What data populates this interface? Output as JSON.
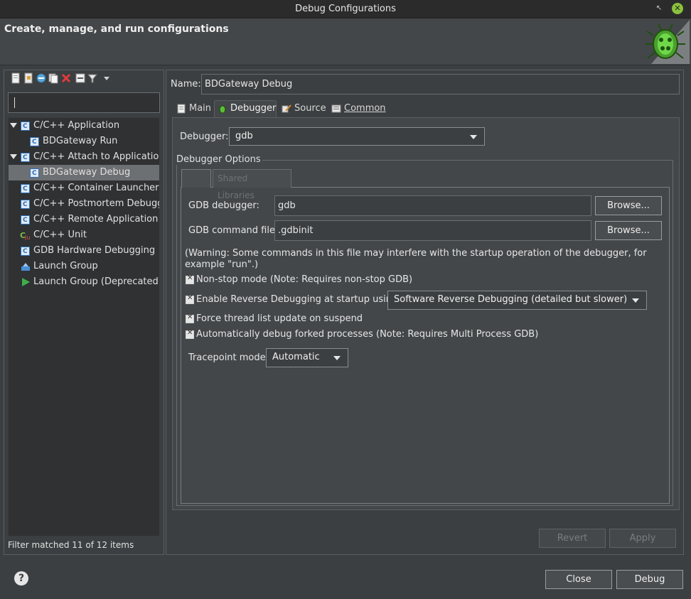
{
  "window": {
    "title": "Debug Configurations",
    "restore_glyph": "↖",
    "close_glyph": "✕"
  },
  "header": {
    "title": "Create, manage, and run configurations"
  },
  "left": {
    "filter_placeholder": "",
    "tree": [
      {
        "label": "C/C++ Application",
        "expanded": true,
        "level": 0
      },
      {
        "label": "BDGateway Run",
        "level": 1
      },
      {
        "label": "C/C++ Attach to Application",
        "expanded": true,
        "level": 0
      },
      {
        "label": "BDGateway Debug",
        "level": 1,
        "selected": true
      },
      {
        "label": "C/C++ Container Launcher",
        "level": 0
      },
      {
        "label": "C/C++ Postmortem Debugger",
        "level": 0
      },
      {
        "label": "C/C++ Remote Application",
        "level": 0
      },
      {
        "label": "C/C++ Unit",
        "level": 0
      },
      {
        "label": "GDB Hardware Debugging",
        "level": 0
      },
      {
        "label": "Launch Group",
        "level": 0
      },
      {
        "label": "Launch Group (Deprecated)",
        "level": 0
      }
    ],
    "status": "Filter matched 11 of 12 items"
  },
  "right": {
    "name_label": "Name:",
    "name_value": "BDGateway Debug",
    "tabs": [
      "Main",
      "Debugger",
      "Source",
      "Common"
    ],
    "active_tab": "Debugger",
    "debugger_label": "Debugger:",
    "debugger_value": "gdb",
    "options_label": "Debugger Options",
    "subtabs": [
      "",
      "Shared Libraries"
    ],
    "gdb_debugger_label": "GDB debugger:",
    "gdb_debugger_value": "gdb",
    "gdb_command_label": "GDB command file:",
    "gdb_command_value": ".gdbinit",
    "browse_label": "Browse...",
    "warning": "(Warning: Some commands in this file may interfere with the startup operation of the debugger, for example \"run\".)",
    "nonstop_label": "Non-stop mode (Note: Requires non-stop GDB)",
    "reverse_label": "Enable Reverse Debugging at startup using:",
    "reverse_value": "Software Reverse Debugging (detailed but slower)",
    "force_label": "Force thread list update on suspend",
    "forked_label": "Automatically debug forked processes (Note: Requires Multi Process GDB)",
    "tracepoint_label": "Tracepoint mode:",
    "tracepoint_value": "Automatic",
    "revert_label": "Revert",
    "apply_label": "Apply"
  },
  "footer": {
    "help": "?",
    "close_label": "Close",
    "debug_label": "Debug"
  },
  "colors": {
    "accent_close": "#8bbf3f",
    "bg": "#3c3f41",
    "selected_row": "#6d7073"
  }
}
